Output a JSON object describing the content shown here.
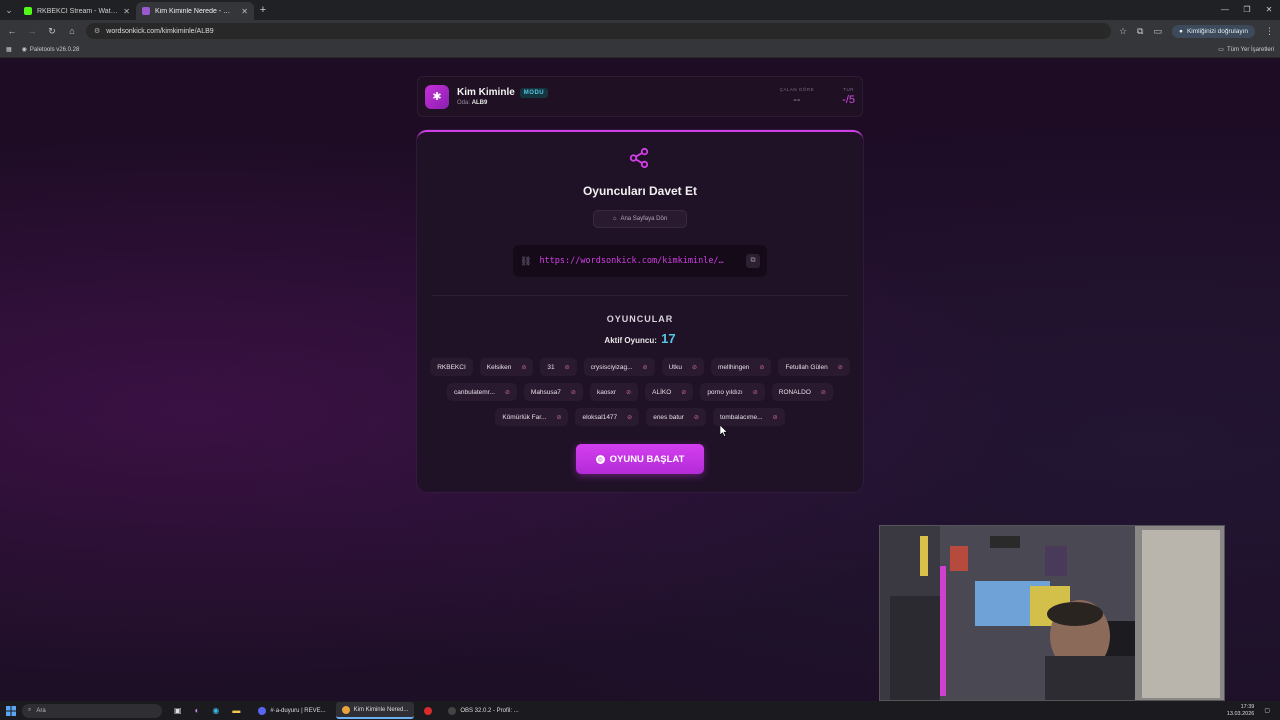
{
  "browser": {
    "tabs": [
      {
        "title": "RKBEKCI Stream - Watch Live o",
        "favicon_color": "#53fc18",
        "active": false
      },
      {
        "title": "Kim Kiminle Nerede - Words O",
        "favicon_color": "#9b59d0",
        "active": true
      }
    ],
    "url": "wordsonkick.com/kimkiminle/ALB9",
    "verify_label": "Kimliğinizi doğrulayın",
    "bookmark": "Paletools v26.0.28",
    "all_bookmarks": "Tüm Yer İşaretleri"
  },
  "header": {
    "title": "Kim Kiminle",
    "mode_badge": "MODU",
    "room_label": "Oda:",
    "room_code": "ALB9",
    "stat_drawer_label": "ÇALAN GÖRE",
    "stat_drawer_value": "--",
    "stat_round_label": "TUR",
    "stat_round_value": "-/5"
  },
  "invite": {
    "title": "Oyuncuları Davet Et",
    "home_button": "Ana Sayfaya Dön",
    "link": "https://wordsonkick.com/kimkiminle/…"
  },
  "players": {
    "title": "OYUNCULAR",
    "active_label": "Aktif Oyuncu:",
    "active_count": "17",
    "list": [
      {
        "name": "RKBEKCI",
        "kick": false
      },
      {
        "name": "Kelsiken",
        "kick": true
      },
      {
        "name": "31",
        "kick": true
      },
      {
        "name": "crysisciyizag...",
        "kick": true
      },
      {
        "name": "Utku",
        "kick": true
      },
      {
        "name": "mellhingen",
        "kick": true
      },
      {
        "name": "Fetullah Gülen",
        "kick": true
      },
      {
        "name": "canbulatemr...",
        "kick": true
      },
      {
        "name": "Mahsusa7",
        "kick": true
      },
      {
        "name": "kaosxr",
        "kick": true
      },
      {
        "name": "ALİKO",
        "kick": true
      },
      {
        "name": "porno yıldızı",
        "kick": true
      },
      {
        "name": "RONALDO",
        "kick": true
      },
      {
        "name": "Kömürlük Far...",
        "kick": true
      },
      {
        "name": "eloksal1477",
        "kick": true
      },
      {
        "name": "enes batur",
        "kick": true
      },
      {
        "name": "tombalacıme...",
        "kick": true
      }
    ]
  },
  "start_button": "OYUNU BAŞLAT",
  "taskbar": {
    "search_placeholder": "Ara",
    "apps": [
      {
        "label": "#·a-duyuru | REVE...",
        "color": "#5865f2",
        "active": false
      },
      {
        "label": "Kim Kiminle Nered...",
        "color": "#e8a33d",
        "active": true
      },
      {
        "label": "",
        "color": "#d92b2b",
        "active": false
      },
      {
        "label": "OBS 32.0.2 - Profil: ...",
        "color": "#444",
        "active": false
      }
    ],
    "time": "17:39",
    "date": "13.03.2026"
  },
  "colors": {
    "accent": "#d33fe6",
    "cyan": "#56c6e6",
    "page_bg": "#1f0d26"
  }
}
